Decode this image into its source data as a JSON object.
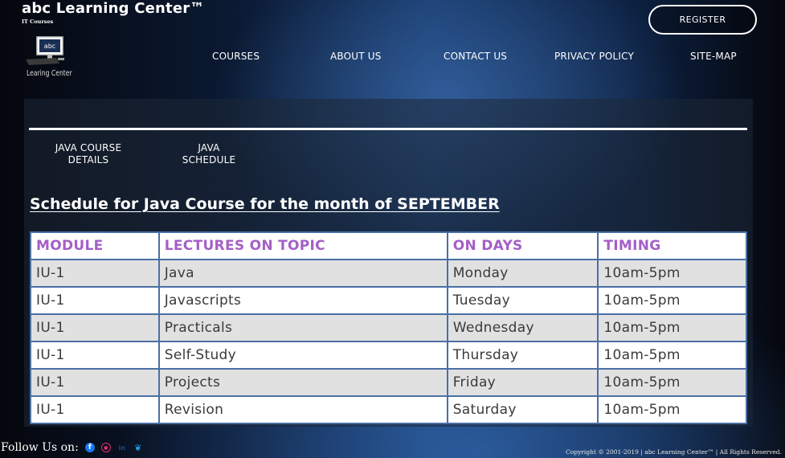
{
  "brand": {
    "title": "abc Learning Center™",
    "subtitle": "IT Courses",
    "logo_text": "abc",
    "logo_caption": "Learing Center"
  },
  "header": {
    "register_label": "REGISTER"
  },
  "nav": {
    "courses": "COURSES",
    "about": "ABOUT US",
    "contact": "CONTACT US",
    "privacy": "PRIVACY POLICY",
    "sitemap": "SITE-MAP"
  },
  "subnav": {
    "details_line1": "JAVA COURSE",
    "details_line2": "DETAILS",
    "schedule_line1": "JAVA",
    "schedule_line2": "SCHEDULE"
  },
  "main": {
    "title": "Schedule for Java Course for the month of SEPTEMBER"
  },
  "table": {
    "headers": [
      "MODULE",
      "LECTURES ON TOPIC",
      "ON DAYS",
      "TIMING"
    ],
    "rows": [
      [
        "IU-1",
        "Java",
        "Monday",
        "10am-5pm"
      ],
      [
        "IU-1",
        "Javascripts",
        "Tuesday",
        "10am-5pm"
      ],
      [
        "IU-1",
        "Practicals",
        "Wednesday",
        "10am-5pm"
      ],
      [
        "IU-1",
        "Self-Study",
        "Thursday",
        "10am-5pm"
      ],
      [
        "IU-1",
        "Projects",
        "Friday",
        "10am-5pm"
      ],
      [
        "IU-1",
        "Revision",
        "Saturday",
        "10am-5pm"
      ]
    ]
  },
  "footer": {
    "follow_label": "Follow Us on:",
    "social_icons": [
      "facebook-icon",
      "instagram-icon",
      "linkedin-icon",
      "twitter-icon"
    ],
    "copyright": "Copyright © 2001-2019 | abc Learning Center™ | All Rights Reserved."
  },
  "colors": {
    "table_header_text": "#a45fc6",
    "table_border": "#4a6fa5",
    "row_alt": "#e1e1e1",
    "facebook": "#1877f2",
    "instagram": "#e1306c",
    "twitter": "#1da1f2"
  }
}
